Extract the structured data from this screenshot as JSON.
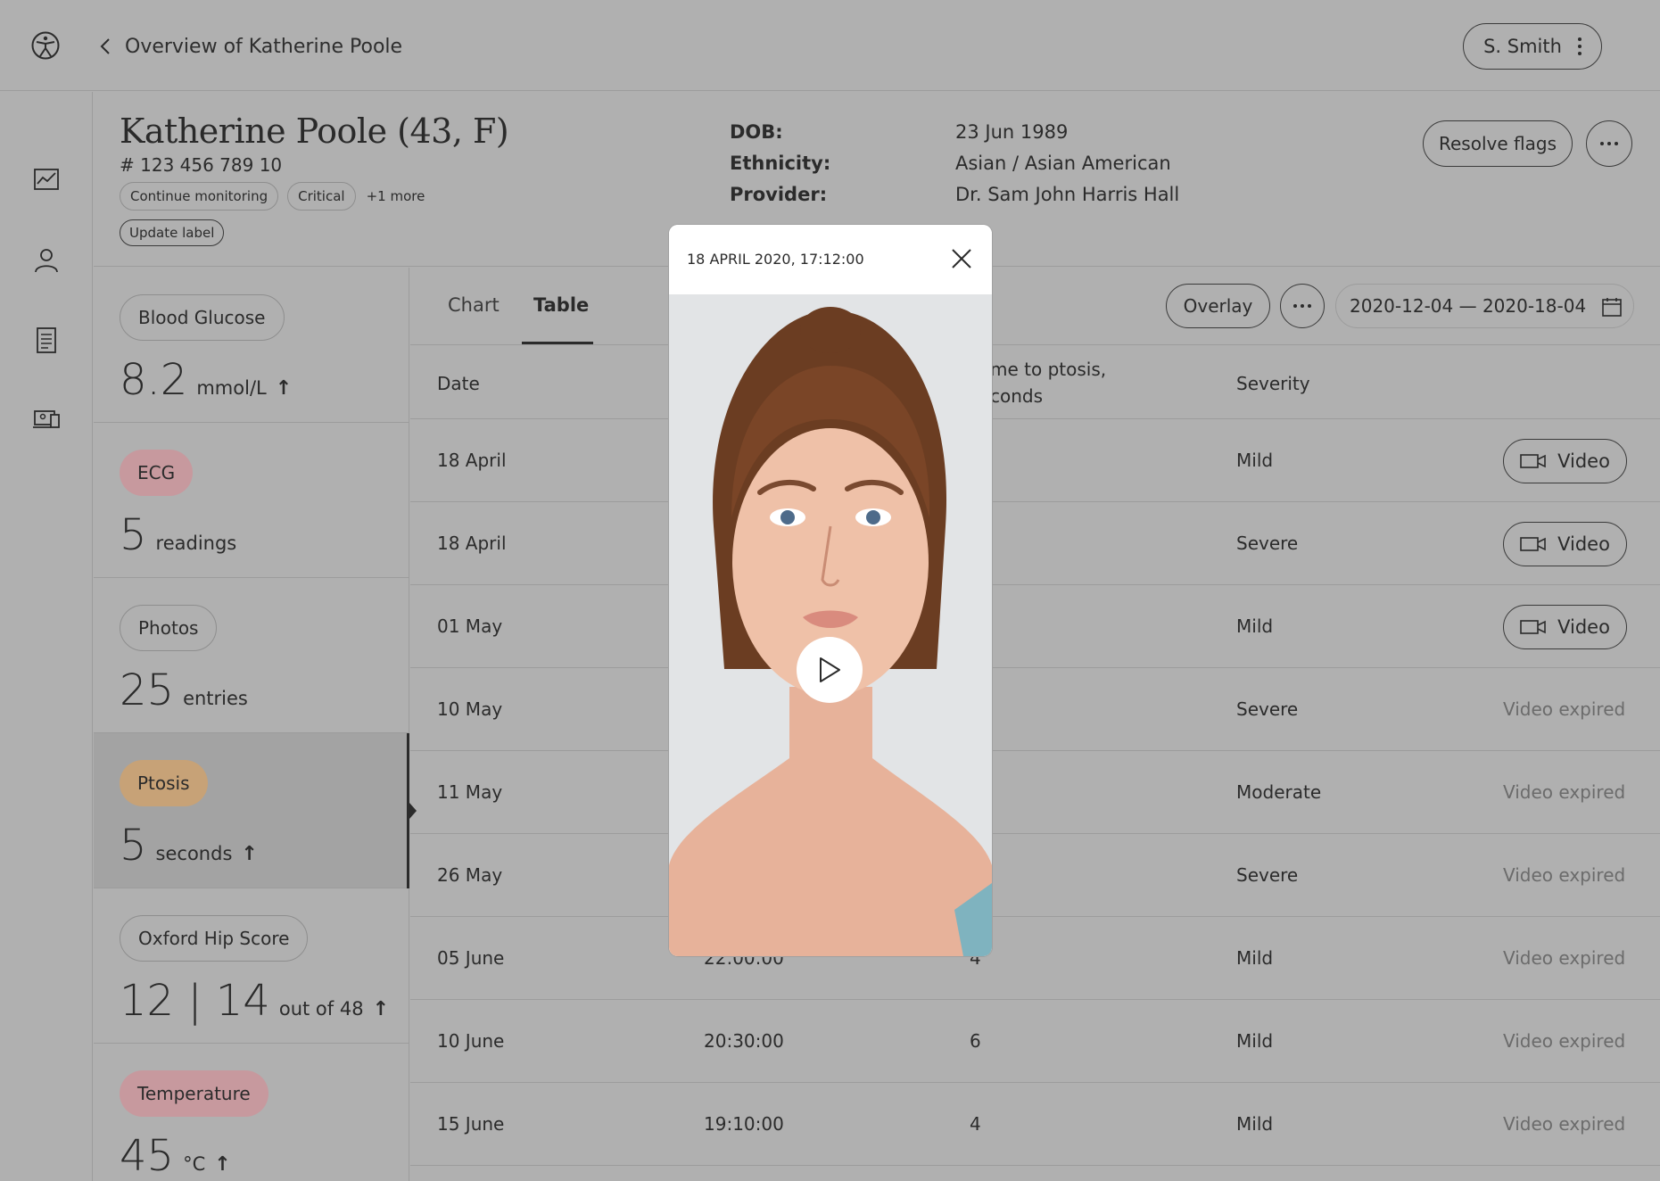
{
  "topbar": {
    "back_label": "Overview of Katherine Poole",
    "user_label": "S. Smith"
  },
  "patient": {
    "name": "Katherine Poole (43, F)",
    "id": "# 123 456 789 10",
    "tags": [
      "Continue monitoring",
      "Critical"
    ],
    "more_tags": "+1 more",
    "update_label": "Update label",
    "info": [
      {
        "key": "DOB:",
        "value": "23 Jun 1989"
      },
      {
        "key": "Ethnicity:",
        "value": "Asian / Asian American"
      },
      {
        "key": "Provider:",
        "value": "Dr. Sam John Harris Hall"
      }
    ],
    "resolve_label": "Resolve flags"
  },
  "metrics": [
    {
      "label": "Blood Glucose",
      "value": "8.2",
      "unit": "mmol/L",
      "trend": "↑"
    },
    {
      "label": "ECG",
      "value": "5",
      "unit": "readings",
      "trend": ""
    },
    {
      "label": "Photos",
      "value": "25",
      "unit": "entries",
      "trend": ""
    },
    {
      "label": "Ptosis",
      "value": "5",
      "unit": "seconds",
      "trend": "↑"
    },
    {
      "label": "Oxford Hip Score",
      "value": "12 | 14",
      "unit": "out of 48",
      "trend": "↑"
    },
    {
      "label": "Temperature",
      "value": "45",
      "unit": "°C",
      "trend": "↑"
    }
  ],
  "tabs": {
    "chart": "Chart",
    "table": "Table",
    "overlay": "Overlay",
    "date_range": "2020-12-04 — 2020-18-04"
  },
  "table": {
    "headers": {
      "date": "Date",
      "time_to_ptosis_line1": "me to ptosis,",
      "time_to_ptosis_line2": "conds",
      "severity": "Severity"
    },
    "rows": [
      {
        "date": "18 April",
        "time": "",
        "value": "",
        "severity": "Mild",
        "video": "Video"
      },
      {
        "date": "18 April",
        "time": "",
        "value": "",
        "severity": "Severe",
        "video": "Video"
      },
      {
        "date": "01 May",
        "time": "",
        "value": "",
        "severity": "Mild",
        "video": "Video"
      },
      {
        "date": "10 May",
        "time": "",
        "value": "",
        "severity": "Severe",
        "video": "Video expired"
      },
      {
        "date": "11 May",
        "time": "",
        "value": "",
        "severity": "Moderate",
        "video": "Video expired"
      },
      {
        "date": "26 May",
        "time": "",
        "value": "",
        "severity": "Severe",
        "video": "Video expired"
      },
      {
        "date": "05 June",
        "time": "22:00:00",
        "value": "4",
        "severity": "Mild",
        "video": "Video expired"
      },
      {
        "date": "10 June",
        "time": "20:30:00",
        "value": "6",
        "severity": "Mild",
        "video": "Video expired"
      },
      {
        "date": "15 June",
        "time": "19:10:00",
        "value": "4",
        "severity": "Mild",
        "video": "Video expired"
      }
    ]
  },
  "modal": {
    "title": "18 APRIL 2020, 17:12:00"
  },
  "colors": {
    "pink_chip": "#c7999e",
    "tan_chip": "#c7a277",
    "backdrop": "#b0b0b0"
  }
}
